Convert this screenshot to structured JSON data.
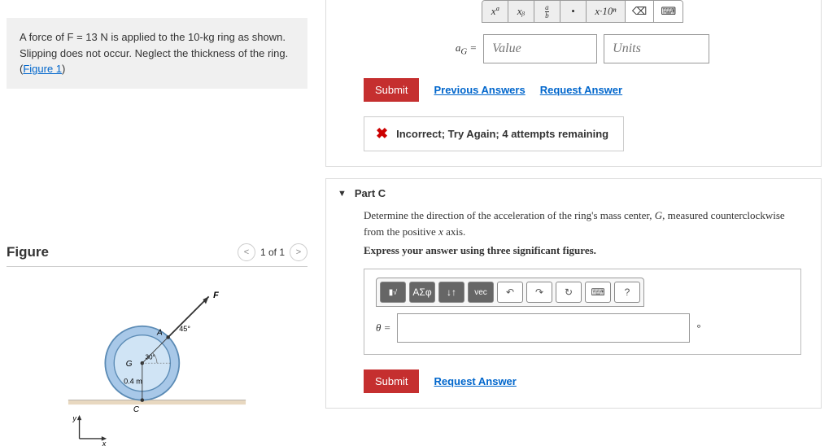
{
  "problem": {
    "text_before_link": "A force of F = 13  N is applied to the 10-kg ring as shown. Slipping does not occur. Neglect the thickness of the ring. (",
    "link_text": "Figure 1",
    "text_after_link": ")"
  },
  "figure": {
    "title": "Figure",
    "page_text": "1 of 1",
    "labels": {
      "F": "F",
      "A": "A",
      "G": "G",
      "C": "C",
      "angle45": "45°",
      "angle30": "30°",
      "radius": "0.4 m",
      "x": "x",
      "y": "y"
    }
  },
  "partB": {
    "sym": {
      "xa": "xª",
      "xb": "xᵦ",
      "frac": "a/b",
      "dot": "•",
      "xten": "x·10ⁿ",
      "bksp": "⌫",
      "keyb": "⌨"
    },
    "var": "a_G =",
    "value_placeholder": "Value",
    "units_placeholder": "Units",
    "submit": "Submit",
    "prev": "Previous Answers",
    "req": "Request Answer",
    "feedback": "Incorrect; Try Again; 4 attempts remaining"
  },
  "partC": {
    "title": "Part C",
    "prompt": "Determine the direction of the acceleration of the ring's mass center, G, measured counterclockwise from the positive x axis.",
    "instruction": "Express your answer using three significant figures.",
    "toolbar": {
      "templ": "▮√",
      "greek": "ΑΣφ",
      "arrows": "↓↑",
      "vec": "vec",
      "undo": "↶",
      "redo": "↷",
      "reset": "↻",
      "keyb": "⌨",
      "help": "?"
    },
    "var": "θ =",
    "unit": "°",
    "submit": "Submit",
    "req": "Request Answer"
  }
}
